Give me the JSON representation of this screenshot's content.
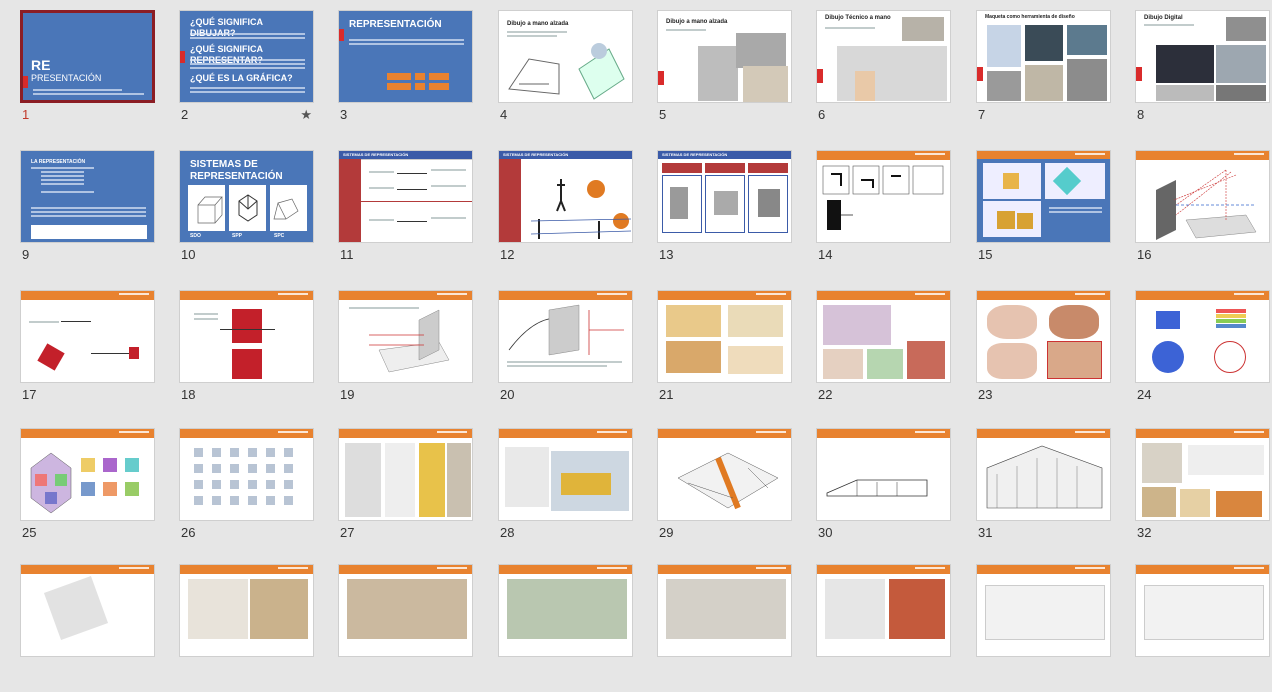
{
  "slides": [
    {
      "number": "1",
      "selected": true,
      "title": "RE",
      "subtitle": "PRESENTACIÓN"
    },
    {
      "number": "2",
      "title1": "¿QUÉ SIGNIFICA DIBUJAR?",
      "title2": "¿QUÉ SIGNIFICA REPRESENTAR?",
      "title3": "¿QUÉ ES LA GRÁFICA?",
      "star": "★"
    },
    {
      "number": "3",
      "title": "REPRESENTACIÓN"
    },
    {
      "number": "4",
      "title": "Dibujo a mano alzada"
    },
    {
      "number": "5",
      "title": "Dibujo a mano alzada"
    },
    {
      "number": "6",
      "title": "Dibujo Técnico a mano"
    },
    {
      "number": "7",
      "title": "Maqueta como herramienta de diseño"
    },
    {
      "number": "8",
      "title": "Dibujo Digital"
    },
    {
      "number": "9",
      "title": "LA REPRESENTACIÓN"
    },
    {
      "number": "10",
      "title": "SISTEMAS DE REPRESENTACIÓN",
      "labels": [
        "SDO",
        "SPP",
        "SPC"
      ]
    },
    {
      "number": "11",
      "title": "SISTEMAS DE REPRESENTACIÓN"
    },
    {
      "number": "12",
      "title": "SISTEMAS DE REPRESENTACIÓN"
    },
    {
      "number": "13",
      "title": "SISTEMAS DE REPRESENTACIÓN"
    },
    {
      "number": "14"
    },
    {
      "number": "15"
    },
    {
      "number": "16"
    },
    {
      "number": "17"
    },
    {
      "number": "18"
    },
    {
      "number": "19"
    },
    {
      "number": "20"
    },
    {
      "number": "21"
    },
    {
      "number": "22"
    },
    {
      "number": "23"
    },
    {
      "number": "24"
    },
    {
      "number": "25"
    },
    {
      "number": "26"
    },
    {
      "number": "27"
    },
    {
      "number": "28"
    },
    {
      "number": "29"
    },
    {
      "number": "30"
    },
    {
      "number": "31"
    },
    {
      "number": "32"
    },
    {
      "number": ""
    },
    {
      "number": ""
    },
    {
      "number": ""
    },
    {
      "number": ""
    },
    {
      "number": ""
    },
    {
      "number": ""
    },
    {
      "number": ""
    },
    {
      "number": ""
    }
  ],
  "colors": {
    "accent_blue": "#4a76b8",
    "accent_orange": "#e8822f",
    "accent_red": "#b33a3a",
    "selection": "#8b1d24"
  }
}
